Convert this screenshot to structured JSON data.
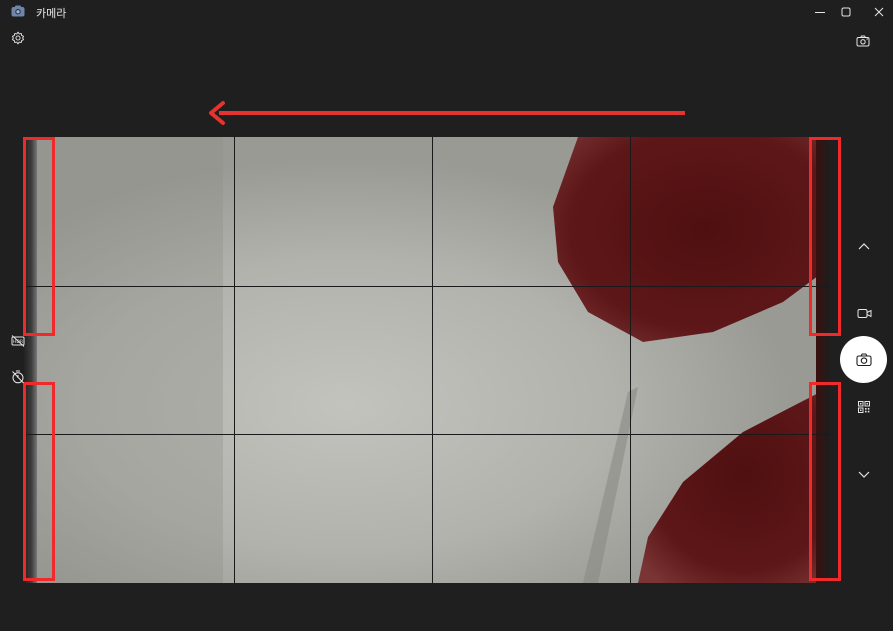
{
  "window": {
    "title": "카메라",
    "controls": [
      "minimize-icon",
      "maximize-icon",
      "close-icon"
    ]
  },
  "toolbar": {
    "settings_icon": "gear-icon",
    "switch_camera_icon": "switch-camera-icon"
  },
  "left_controls": {
    "icons": [
      "hdr-off-icon",
      "timer-icon"
    ]
  },
  "mode_selector": {
    "icons": [
      "chevron-up-icon",
      "video-icon",
      "camera-icon",
      "qr-code-icon",
      "chevron-down-icon"
    ],
    "selected": "camera-icon"
  },
  "viewfinder": {
    "grid": "3x3",
    "subject_color": "#5a1414",
    "background_color": "#a8a8a3"
  },
  "annotations": {
    "arrow_color": "#e53330",
    "arrow_direction": "left",
    "box_color": "#f02a2a"
  }
}
